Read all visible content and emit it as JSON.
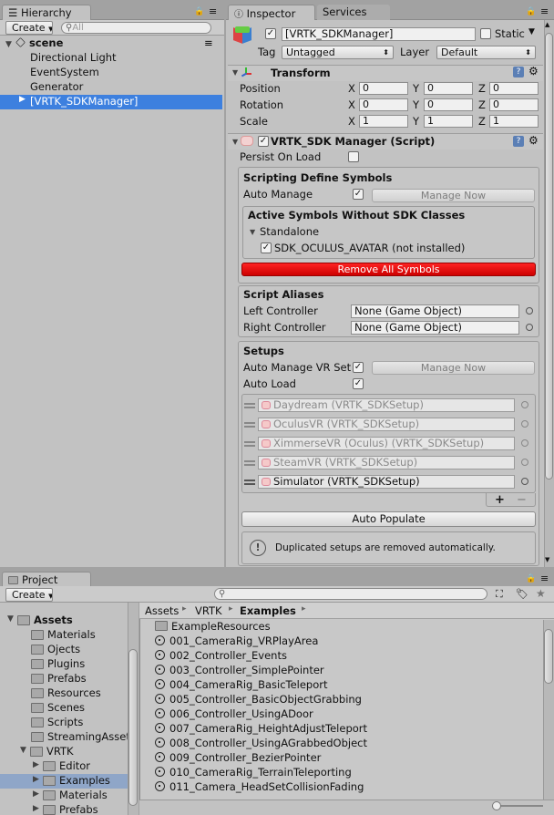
{
  "hierarchy": {
    "tab_label": "Hierarchy",
    "create_label": "Create",
    "search_placeholder": "All",
    "scene_name": "scene",
    "items": [
      "Directional Light",
      "EventSystem",
      "Generator",
      "[VRTK_SDKManager]"
    ]
  },
  "inspector": {
    "tab_label": "Inspector",
    "services_tab_label": "Services",
    "object_name": "[VRTK_SDKManager]",
    "static_label": "Static",
    "tag_label": "Tag",
    "tag_value": "Untagged",
    "layer_label": "Layer",
    "layer_value": "Default",
    "transform": {
      "title": "Transform",
      "rows": [
        {
          "label": "Position",
          "x": "0",
          "y": "0",
          "z": "0"
        },
        {
          "label": "Rotation",
          "x": "0",
          "y": "0",
          "z": "0"
        },
        {
          "label": "Scale",
          "x": "1",
          "y": "1",
          "z": "1"
        }
      ],
      "axis_x": "X",
      "axis_y": "Y",
      "axis_z": "Z"
    },
    "script": {
      "title": "VRTK_SDK Manager (Script)",
      "persist_label": "Persist On Load",
      "define_symbols_title": "Scripting Define Symbols",
      "auto_manage_label": "Auto Manage",
      "manage_now_label": "Manage Now",
      "active_symbols_title": "Active Symbols Without SDK Classes",
      "standalone_label": "Standalone",
      "symbol_item": "SDK_OCULUS_AVATAR (not installed)",
      "remove_all_label": "Remove All Symbols",
      "aliases_title": "Script Aliases",
      "left_controller_label": "Left Controller",
      "left_controller_value": "None (Game Object)",
      "right_controller_label": "Right Controller",
      "right_controller_value": "None (Game Object)",
      "setups_title": "Setups",
      "auto_manage_vr_label": "Auto Manage VR Set",
      "manage_now2_label": "Manage Now",
      "auto_load_label": "Auto Load",
      "setups": [
        "Daydream (VRTK_SDKSetup)",
        "OculusVR (VRTK_SDKSetup)",
        "XimmerseVR (Oculus) (VRTK_SDKSetup)",
        "SteamVR (VRTK_SDKSetup)",
        "Simulator (VRTK_SDKSetup)"
      ],
      "plus_label": "+",
      "minus_label": "−",
      "auto_populate_label": "Auto Populate",
      "info_message": "Duplicated setups are removed automatically."
    }
  },
  "project": {
    "tab_label": "Project",
    "create_label": "Create",
    "tree": [
      {
        "label": "Assets",
        "bold": true
      },
      {
        "label": "Materials"
      },
      {
        "label": "Ojects"
      },
      {
        "label": "Plugins"
      },
      {
        "label": "Prefabs"
      },
      {
        "label": "Resources"
      },
      {
        "label": "Scenes"
      },
      {
        "label": "Scripts"
      },
      {
        "label": "StreamingAssets"
      },
      {
        "label": "VRTK"
      },
      {
        "label": "Editor"
      },
      {
        "label": "Examples"
      },
      {
        "label": "Materials"
      },
      {
        "label": "Prefabs"
      }
    ],
    "breadcrumb": [
      "Assets",
      "VRTK",
      "Examples"
    ],
    "files": [
      "ExampleResources",
      "001_CameraRig_VRPlayArea",
      "002_Controller_Events",
      "003_Controller_SimplePointer",
      "004_CameraRig_BasicTeleport",
      "005_Controller_BasicObjectGrabbing",
      "006_Controller_UsingADoor",
      "007_CameraRig_HeightAdjustTeleport",
      "008_Controller_UsingAGrabbedObject",
      "009_Controller_BezierPointer",
      "010_CameraRig_TerrainTeleporting",
      "011_Camera_HeadSetCollisionFading"
    ]
  },
  "icons": [
    "hierarchy-icon",
    "lock-icon",
    "menu-icon",
    "search-icon",
    "unity-scene-icon",
    "info-icon",
    "folder-icon",
    "unity-file-icon",
    "help-icon",
    "gear-icon",
    "star-icon",
    "tag-icon"
  ]
}
